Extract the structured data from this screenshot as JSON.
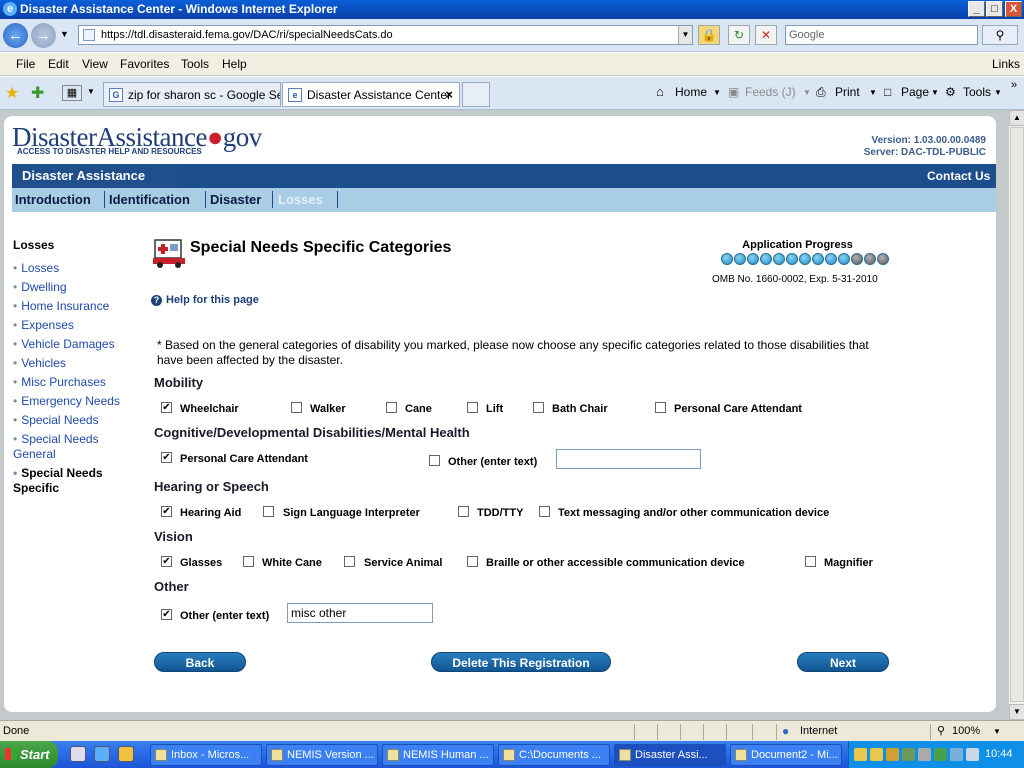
{
  "window": {
    "title": "Disaster Assistance Center - Windows Internet Explorer",
    "min": "_",
    "max": "□",
    "close": "X"
  },
  "address": {
    "url": "https://tdl.disasteraid.fema.gov/DAC/ri/specialNeedsCats.do",
    "search_placeholder": "Google"
  },
  "menu": [
    "File",
    "Edit",
    "View",
    "Favorites",
    "Tools",
    "Help"
  ],
  "links": "Links",
  "tabs": [
    {
      "label": "zip for sharon sc - Google Se...",
      "icon": "G"
    },
    {
      "label": "Disaster Assistance Center",
      "icon": "e"
    }
  ],
  "commands": {
    "home": "Home",
    "feeds": "Feeds (J)",
    "print": "Print",
    "page": "Page",
    "tools": "Tools"
  },
  "header": {
    "logo_main": "DisasterAssistance",
    "logo_gov": "gov",
    "tagline": "ACCESS TO DISASTER HELP AND RESOURCES",
    "version": "Version: 1.03.00.00.0489",
    "server": "Server: DAC-TDL-PUBLIC",
    "banner_title": "Disaster Assistance",
    "contact": "Contact Us"
  },
  "steps": [
    "Introduction",
    "Identification",
    "Disaster",
    "Losses"
  ],
  "leftnav": {
    "title": "Losses",
    "items": [
      "Losses",
      "Dwelling",
      "Home Insurance",
      "Expenses",
      "Vehicle Damages",
      "Vehicles",
      "Misc Purchases",
      "Emergency Needs",
      "Special Needs",
      "Special Needs General",
      "Special Needs Specific"
    ]
  },
  "main": {
    "title": "Special Needs Specific Categories",
    "progress_title": "Application Progress",
    "progress": {
      "completed": 10,
      "total": 13
    },
    "colors": {
      "done": "#1a8fc8",
      "todo": "#5a5a5a"
    },
    "omb": "OMB No. 1660-0002, Exp. 5-31-2010",
    "help": "Help for this page",
    "intro": "* Based on the general categories of disability you marked, please now choose any specific categories related to those disabilities that have been affected by the disaster."
  },
  "sections": {
    "mobility": {
      "title": "Mobility",
      "options": [
        "Wheelchair",
        "Walker",
        "Cane",
        "Lift",
        "Bath Chair",
        "Personal Care Attendant"
      ],
      "checked": [
        true,
        false,
        false,
        false,
        false,
        false
      ]
    },
    "cognitive": {
      "title": "Cognitive/Developmental Disabilities/Mental Health",
      "options": [
        "Personal Care Attendant",
        "Other (enter text)"
      ],
      "checked": [
        true,
        false
      ],
      "other_value": ""
    },
    "hearing": {
      "title": "Hearing or Speech",
      "options": [
        "Hearing Aid",
        "Sign Language Interpreter",
        "TDD/TTY",
        "Text messaging and/or other communication device"
      ],
      "checked": [
        true,
        false,
        false,
        false
      ]
    },
    "vision": {
      "title": "Vision",
      "options": [
        "Glasses",
        "White Cane",
        "Service Animal",
        "Braille or other accessible communication device",
        "Magnifier"
      ],
      "checked": [
        true,
        false,
        false,
        false,
        false
      ]
    },
    "other": {
      "title": "Other",
      "options": [
        "Other (enter text)"
      ],
      "checked": [
        true
      ],
      "other_value": "misc other"
    }
  },
  "buttons": {
    "back": "Back",
    "delete": "Delete This Registration",
    "next": "Next"
  },
  "status": {
    "text": "Done",
    "zone": "Internet",
    "zoom": "100%"
  },
  "taskbar": {
    "start": "Start",
    "tasks": [
      "Inbox - Micros...",
      "NEMIS Version ...",
      "NEMIS Human ...",
      "C:\\Documents ...",
      "Disaster Assi...",
      "Document2 - Mi..."
    ],
    "clock": "10:44"
  }
}
